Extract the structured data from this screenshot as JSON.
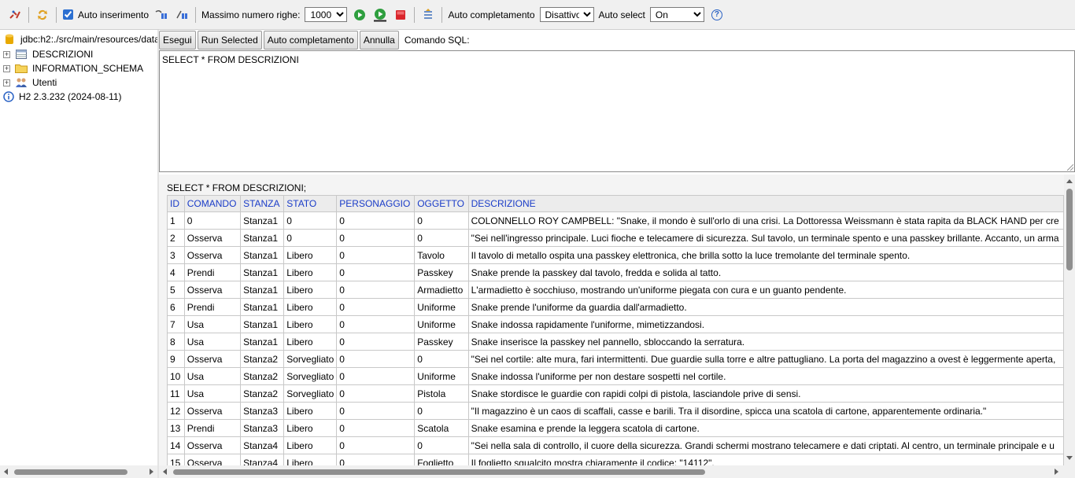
{
  "toolbar": {
    "auto_insert_label": "Auto inserimento",
    "auto_insert_checked": true,
    "max_rows_label": "Massimo numero righe:",
    "max_rows_value": "1000",
    "autocomplete_label": "Auto completamento",
    "autocomplete_value": "Disattivo",
    "autoselect_label": "Auto select",
    "autoselect_value": "On",
    "help_glyph": "?"
  },
  "tree": {
    "connection": "jdbc:h2:./src/main/resources/data",
    "items": [
      {
        "label": "DESCRIZIONI",
        "expander": "+"
      },
      {
        "label": "INFORMATION_SCHEMA",
        "expander": "+"
      },
      {
        "label": "Utenti",
        "expander": "+"
      }
    ],
    "version": "H2 2.3.232 (2024-08-11)"
  },
  "sql": {
    "buttons": {
      "execute": "Esegui",
      "run_selected": "Run Selected",
      "autocomplete": "Auto completamento",
      "cancel": "Annulla"
    },
    "command_label": "Comando SQL:",
    "query": "SELECT * FROM DESCRIZIONI"
  },
  "results": {
    "query": "SELECT * FROM DESCRIZIONI;",
    "columns": [
      "ID",
      "COMANDO",
      "STANZA",
      "STATO",
      "PERSONAGGIO",
      "OGGETTO",
      "DESCRIZIONE"
    ],
    "rows": [
      [
        "1",
        "0",
        "Stanza1",
        "0",
        "0",
        "0",
        "COLONNELLO ROY CAMPBELL: \"Snake, il mondo è sull'orlo di una crisi. La Dottoressa Weissmann è stata rapita da BLACK HAND per cre"
      ],
      [
        "2",
        "Osserva",
        "Stanza1",
        "0",
        "0",
        "0",
        "\"Sei nell'ingresso principale. Luci fioche e telecamere di sicurezza. Sul tavolo, un terminale spento e una passkey brillante. Accanto, un arma"
      ],
      [
        "3",
        "Osserva",
        "Stanza1",
        "Libero",
        "0",
        "Tavolo",
        "Il tavolo di metallo ospita una passkey elettronica, che brilla sotto la luce tremolante del terminale spento."
      ],
      [
        "4",
        "Prendi",
        "Stanza1",
        "Libero",
        "0",
        "Passkey",
        "Snake prende la passkey dal tavolo, fredda e solida al tatto."
      ],
      [
        "5",
        "Osserva",
        "Stanza1",
        "Libero",
        "0",
        "Armadietto",
        "L'armadietto è socchiuso, mostrando un'uniforme piegata con cura e un guanto pendente."
      ],
      [
        "6",
        "Prendi",
        "Stanza1",
        "Libero",
        "0",
        "Uniforme",
        "Snake prende l'uniforme da guardia dall'armadietto."
      ],
      [
        "7",
        "Usa",
        "Stanza1",
        "Libero",
        "0",
        "Uniforme",
        "Snake indossa rapidamente l'uniforme, mimetizzandosi."
      ],
      [
        "8",
        "Usa",
        "Stanza1",
        "Libero",
        "0",
        "Passkey",
        "Snake inserisce la passkey nel pannello, sbloccando la serratura."
      ],
      [
        "9",
        "Osserva",
        "Stanza2",
        "Sorvegliato",
        "0",
        "0",
        "\"Sei nel cortile: alte mura, fari intermittenti. Due guardie sulla torre e altre pattugliano. La porta del magazzino a ovest è leggermente aperta,"
      ],
      [
        "10",
        "Usa",
        "Stanza2",
        "Sorvegliato",
        "0",
        "Uniforme",
        "Snake indossa l'uniforme per non destare sospetti nel cortile."
      ],
      [
        "11",
        "Usa",
        "Stanza2",
        "Sorvegliato",
        "0",
        "Pistola",
        "Snake stordisce le guardie con rapidi colpi di pistola, lasciandole prive di sensi."
      ],
      [
        "12",
        "Osserva",
        "Stanza3",
        "Libero",
        "0",
        "0",
        "\"Il magazzino è un caos di scaffali, casse e barili. Tra il disordine, spicca una scatola di cartone, apparentemente ordinaria.\""
      ],
      [
        "13",
        "Prendi",
        "Stanza3",
        "Libero",
        "0",
        "Scatola",
        "Snake esamina e prende la leggera scatola di cartone."
      ],
      [
        "14",
        "Osserva",
        "Stanza4",
        "Libero",
        "0",
        "0",
        "\"Sei nella sala di controllo, il cuore della sicurezza. Grandi schermi mostrano telecamere e dati criptati. Al centro, un terminale principale e u"
      ],
      [
        "15",
        "Osserva",
        "Stanza4",
        "Libero",
        "0",
        "Foglietto",
        "Il foglietto sgualcito mostra chiaramente il codice: \"14112\"."
      ]
    ]
  }
}
